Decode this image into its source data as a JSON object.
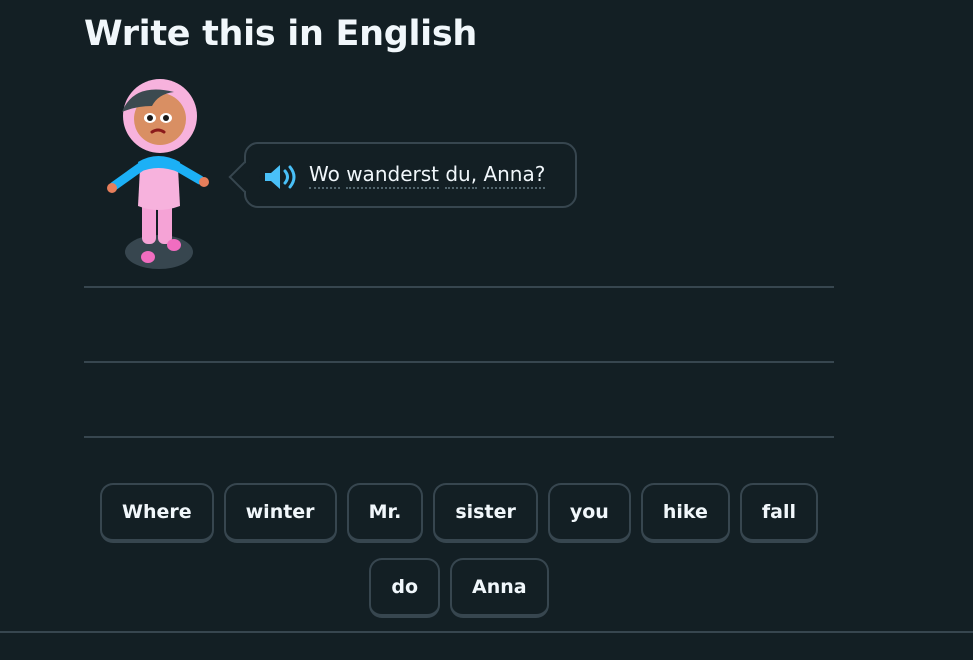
{
  "challenge": {
    "title": "Write this in English"
  },
  "prompt": {
    "words": [
      "Wo",
      "wanderst",
      "du,",
      "Anna?"
    ],
    "speaker_icon": "speaker-icon",
    "character": "Anna character illustration"
  },
  "word_bank": {
    "row1": [
      "Where",
      "winter",
      "Mr.",
      "sister",
      "you",
      "hike",
      "fall"
    ],
    "row2": [
      "do",
      "Anna"
    ]
  },
  "colors": {
    "background": "#131f24",
    "border": "#37464f",
    "text": "#f1f7fb",
    "speaker": "#49c0f8"
  }
}
